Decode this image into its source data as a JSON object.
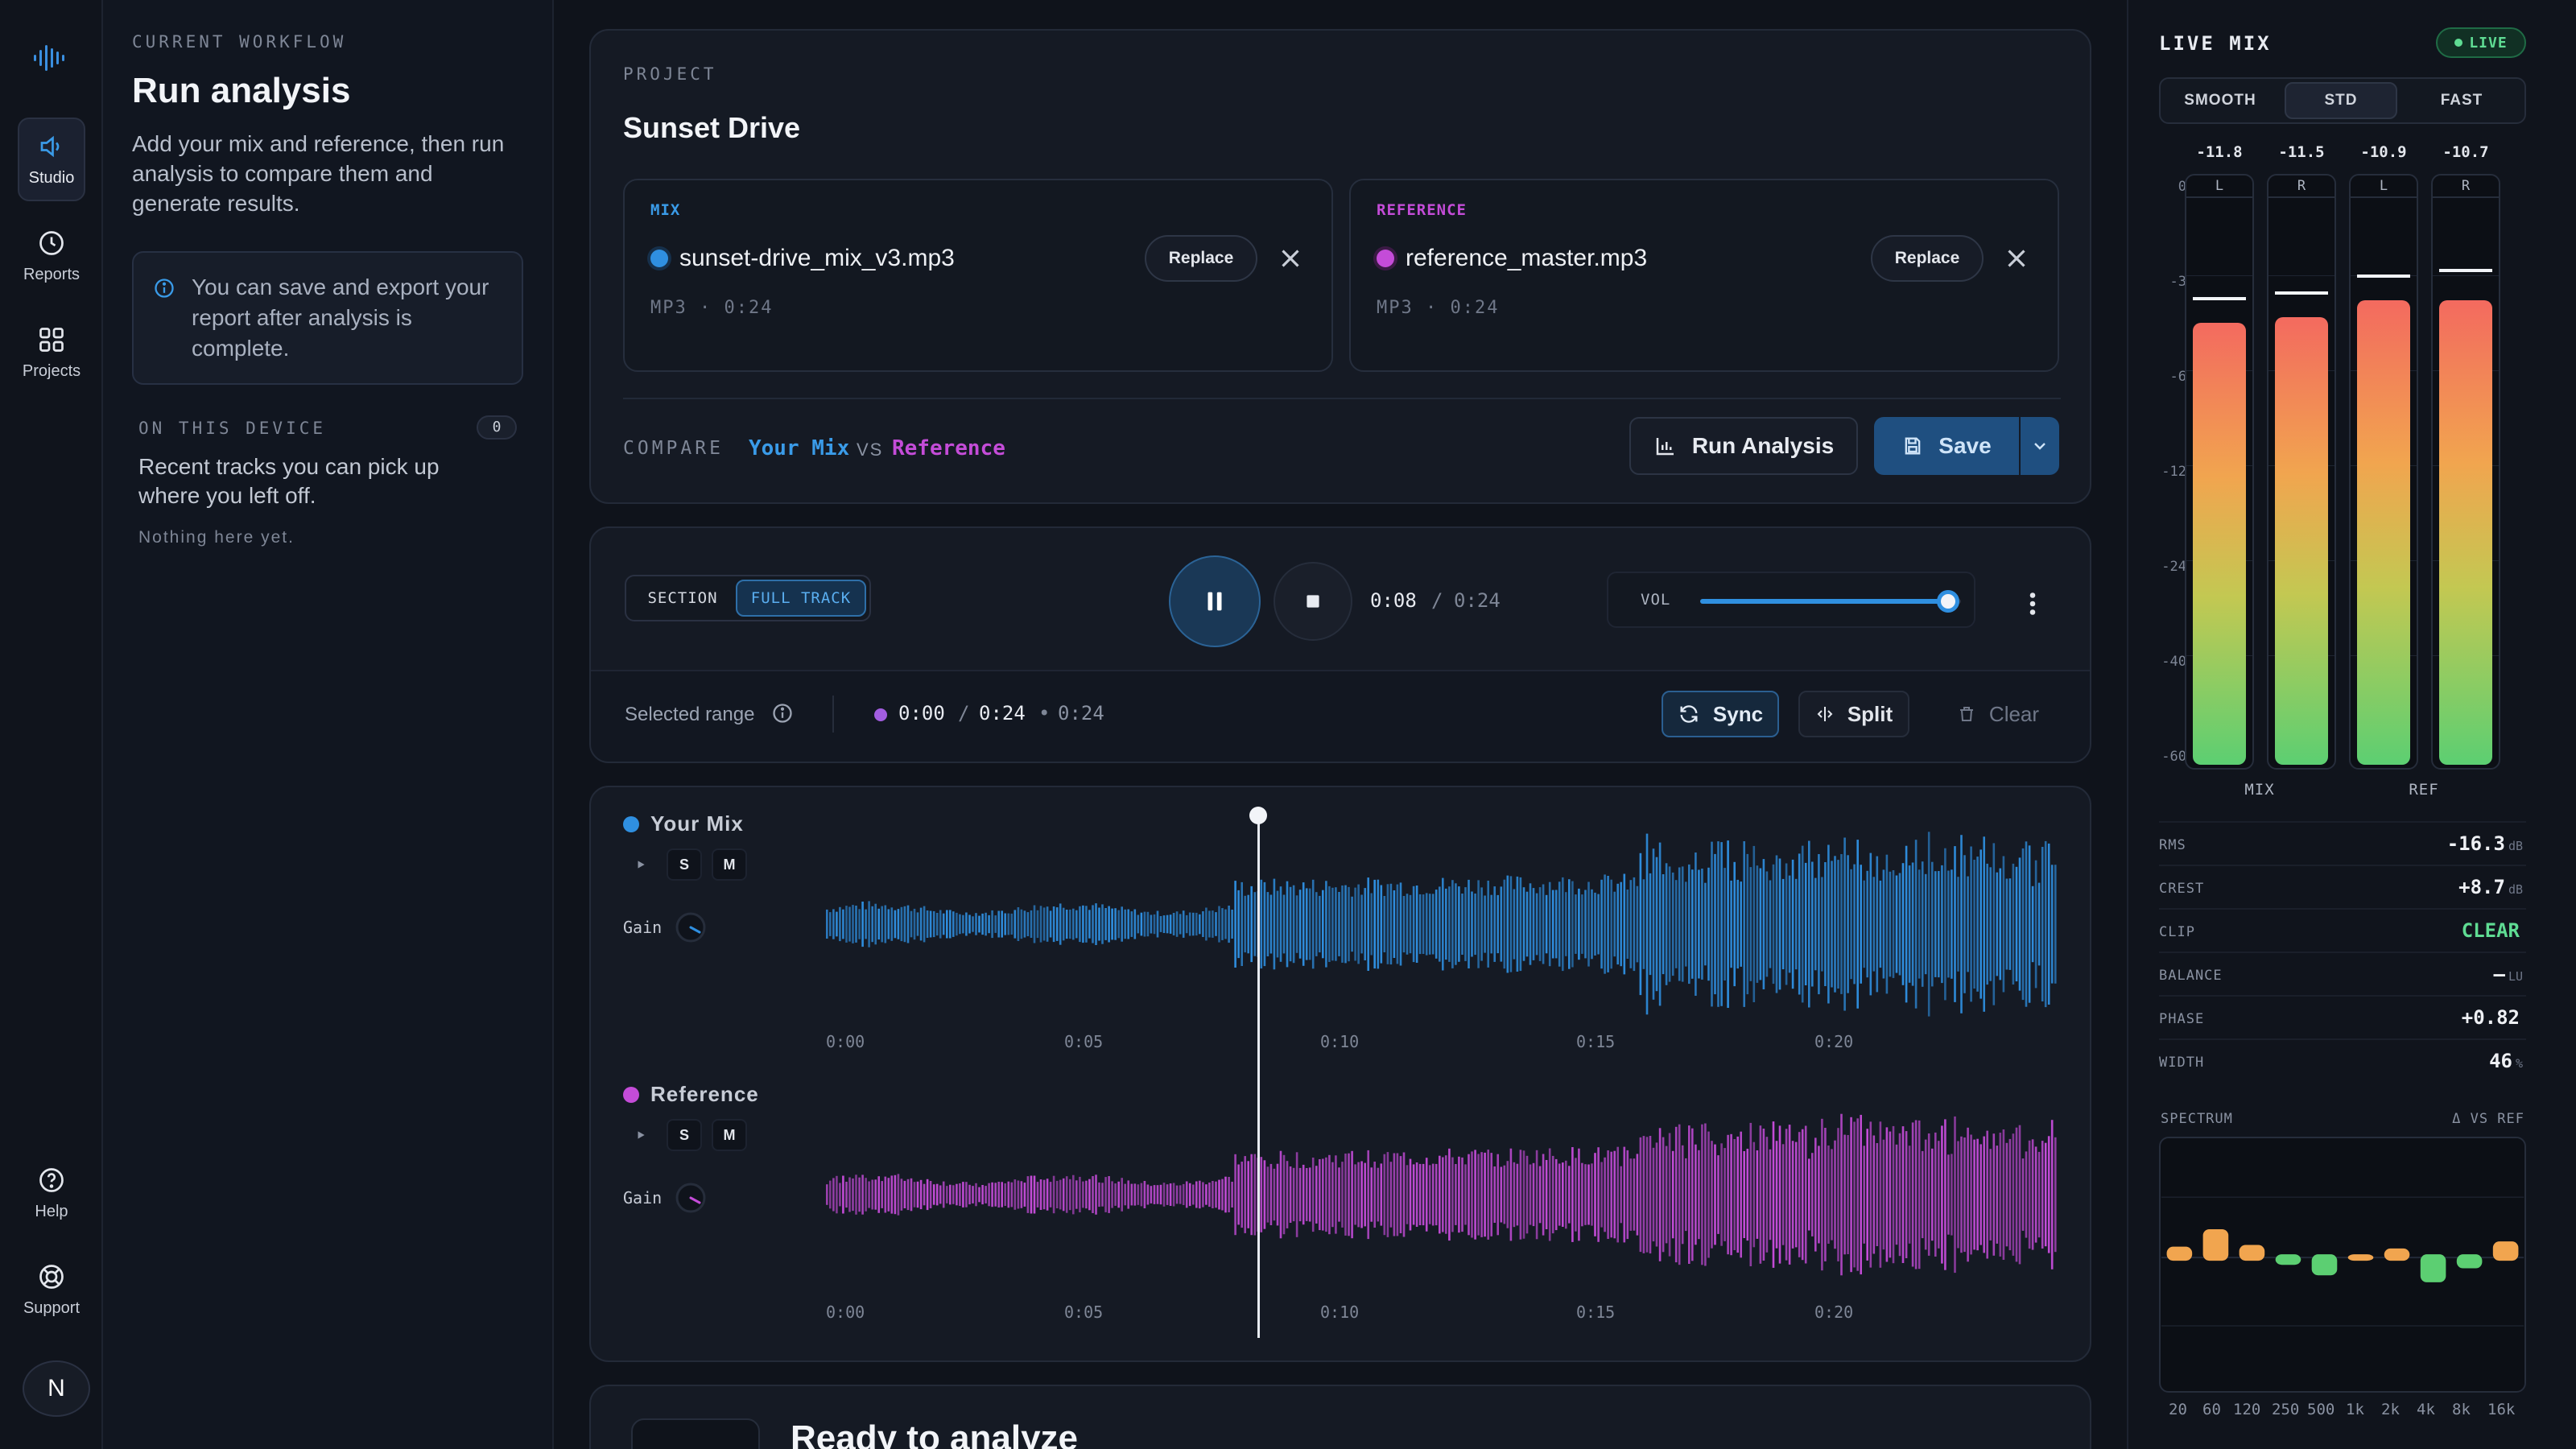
{
  "rail": {
    "items": [
      {
        "label": "Studio",
        "icon": "speaker-icon",
        "active": true
      },
      {
        "label": "Reports",
        "icon": "clock-icon",
        "active": false
      },
      {
        "label": "Projects",
        "icon": "grid-icon",
        "active": false
      }
    ],
    "bottom": [
      {
        "label": "Help",
        "icon": "help-icon"
      },
      {
        "label": "Support",
        "icon": "lifebuoy-icon"
      }
    ],
    "avatar": "N"
  },
  "workflow": {
    "eyebrow": "CURRENT WORKFLOW",
    "title": "Run analysis",
    "description": "Add your mix and reference, then run analysis to compare them and generate results.",
    "note": "You can save and export your report after analysis is complete.",
    "device": {
      "label": "ON THIS DEVICE",
      "count": "0",
      "description": "Recent tracks you can pick up where you left off.",
      "empty": "Nothing here yet."
    }
  },
  "project": {
    "eyebrow": "PROJECT",
    "name": "Sunset Drive",
    "mix": {
      "kind": "MIX",
      "file": "sunset-drive_mix_v3.mp3",
      "meta": "MP3 · 0:24",
      "replace": "Replace",
      "color": "#2f8fe0"
    },
    "reference": {
      "kind": "REFERENCE",
      "file": "reference_master.mp3",
      "meta": "MP3 · 0:24",
      "replace": "Replace",
      "color": "#c44cd8"
    },
    "compare": {
      "label": "COMPARE",
      "a": "Your Mix",
      "vs": "VS",
      "b": "Reference"
    },
    "run_label": "Run Analysis",
    "save_label": "Save"
  },
  "transport": {
    "modes": {
      "section": "SECTION",
      "full": "FULL TRACK",
      "selected": "FULL TRACK"
    },
    "time_current": "0:08",
    "time_sep": "/",
    "time_total": "0:24",
    "volume": {
      "label": "VOL",
      "level": 0.95
    },
    "range": {
      "label": "Selected range",
      "start": "0:00",
      "sep": "/",
      "end": "0:24",
      "bullet": "•",
      "duration": "0:24"
    },
    "sync_label": "Sync",
    "split_label": "Split",
    "clear_label": "Clear"
  },
  "tracks": [
    {
      "name": "Your Mix",
      "color": "#2f8fe0",
      "solo": "S",
      "mute": "M",
      "gain_label": "Gain",
      "ticks": [
        "0:00",
        "0:05",
        "0:10",
        "0:15",
        "0:20"
      ]
    },
    {
      "name": "Reference",
      "color": "#c44cd8",
      "solo": "S",
      "mute": "M",
      "gain_label": "Gain",
      "ticks": [
        "0:00",
        "0:05",
        "0:10",
        "0:15",
        "0:20"
      ]
    }
  ],
  "playhead_fraction": 0.35,
  "ready": {
    "title": "Ready to analyze"
  },
  "live": {
    "title": "LIVE MIX",
    "badge": "LIVE",
    "modes": [
      "SMOOTH",
      "STD",
      "FAST"
    ],
    "active_mode": "STD",
    "db_scale": [
      "0",
      "-3",
      "-6",
      "-12",
      "-24",
      "-40",
      "-60"
    ],
    "meters": [
      {
        "channel": "L",
        "peak": "-11.8",
        "level": 0.78,
        "hold": 0.82
      },
      {
        "channel": "R",
        "peak": "-11.5",
        "level": 0.79,
        "hold": 0.83
      },
      {
        "channel": "L",
        "peak": "-10.9",
        "level": 0.82,
        "hold": 0.86
      },
      {
        "channel": "R",
        "peak": "-10.7",
        "level": 0.82,
        "hold": 0.87
      }
    ],
    "groups": [
      "MIX",
      "REF"
    ],
    "stats": [
      {
        "key": "RMS",
        "value": "-16.3",
        "unit": "dB",
        "color": "#eef0f4"
      },
      {
        "key": "CREST",
        "value": "+8.7",
        "unit": "dB",
        "color": "#eef0f4"
      },
      {
        "key": "CLIP",
        "value": "CLEAR",
        "unit": "",
        "color": "#5fdc93"
      },
      {
        "key": "BALANCE",
        "value": "—",
        "unit": "LU",
        "color": "#eef0f4"
      },
      {
        "key": "PHASE",
        "value": "+0.82",
        "unit": "",
        "color": "#eef0f4"
      },
      {
        "key": "WIDTH",
        "value": "46",
        "unit": "%",
        "color": "#eef0f4"
      }
    ],
    "spectrum": {
      "label": "SPECTRUM",
      "delta_label": "Δ VS REF",
      "freqs": [
        "20",
        "60",
        "120",
        "250",
        "500",
        "1k",
        "2k",
        "4k",
        "8k",
        "16k"
      ],
      "deltas": [
        0.8,
        1.8,
        0.9,
        -0.6,
        -1.2,
        0.3,
        0.7,
        -1.6,
        -0.8,
        1.1
      ],
      "pos_color": "#f1a54f",
      "neg_color": "#5ccf72"
    }
  }
}
